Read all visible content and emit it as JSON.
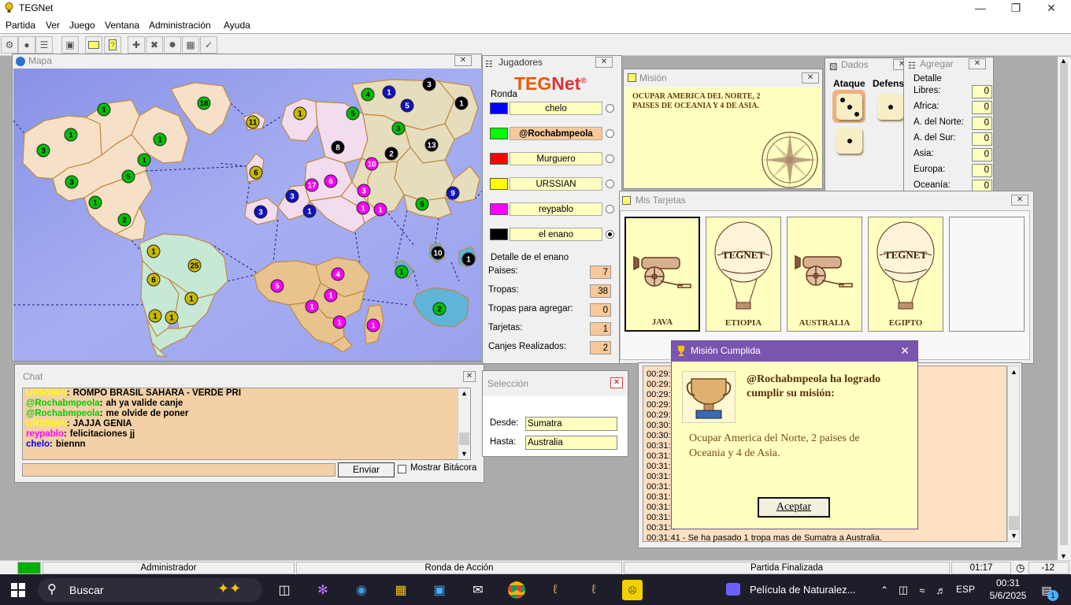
{
  "window": {
    "title": "TEGNet"
  },
  "menu": [
    "Partida",
    "Ver",
    "Juego",
    "Ventana",
    "Administración",
    "Ayuda"
  ],
  "map": {
    "title": "Mapa"
  },
  "players_panel": {
    "title": "Jugadores",
    "logo_teg": "TEG",
    "logo_net": "Net",
    "logo_reg": "®",
    "ronda_label": "Ronda",
    "players": [
      {
        "name": "chelo",
        "color": "#0000ff",
        "selected": false
      },
      {
        "name": "@Rochabmpeola",
        "color": "#00ff00",
        "selected": false
      },
      {
        "name": "Murguero",
        "color": "#ff0000",
        "selected": false
      },
      {
        "name": "URSSIAN",
        "color": "#ffff00",
        "selected": false
      },
      {
        "name": "reypablo",
        "color": "#ff00ff",
        "selected": false
      },
      {
        "name": "el enano",
        "color": "#000000",
        "selected": true
      }
    ],
    "detail_label": "Detalle de el enano",
    "details": [
      {
        "label": "Paises:",
        "value": "7"
      },
      {
        "label": "Tropas:",
        "value": "38"
      },
      {
        "label": "Tropas para agregar:",
        "value": "0"
      },
      {
        "label": "Tarjetas:",
        "value": "1"
      },
      {
        "label": "Canjes Realizados:",
        "value": "2"
      }
    ]
  },
  "mision": {
    "title": "Misión",
    "text_line1": "OCUPAR AMERICA DEL NORTE, 2",
    "text_line2": "PAISES DE OCEANIA Y 4 DE ASIA."
  },
  "dados": {
    "title": "Dados",
    "ataque": "Ataque",
    "defensa": "Defensa",
    "attack": [
      3,
      1
    ],
    "defense": [
      1
    ]
  },
  "agregar": {
    "title": "Agregar",
    "detail_label": "Detalle",
    "rows": [
      {
        "label": "Libres:",
        "value": "0"
      },
      {
        "label": "Africa:",
        "value": "0"
      },
      {
        "label": "A. del Norte:",
        "value": "0"
      },
      {
        "label": "A. del Sur:",
        "value": "0"
      },
      {
        "label": "Asia:",
        "value": "0"
      },
      {
        "label": "Europa:",
        "value": "0"
      },
      {
        "label": "Oceanía:",
        "value": "0"
      }
    ]
  },
  "tarjetas": {
    "title": "Mis Tarjetas",
    "cards": [
      {
        "name": "JAVA",
        "kind": "cannon"
      },
      {
        "name": "ETIOPIA",
        "kind": "balloon",
        "emblem": "TEGNET"
      },
      {
        "name": "AUSTRALIA",
        "kind": "cannon"
      },
      {
        "name": "EGIPTO",
        "kind": "balloon",
        "emblem": "TEGNET"
      }
    ]
  },
  "chat": {
    "title": "Chat",
    "messages": [
      {
        "user": "URSSIAN",
        "sep": ":",
        "text": "ROMPO BRASIL SAHARA - VERDE PRI",
        "color": "#ffff00"
      },
      {
        "user": "@Rochabmpeola",
        "sep": ":",
        "text": "ah ya valide canje",
        "color": "#00d000"
      },
      {
        "user": "@Rochabmpeola",
        "sep": ":",
        "text": "me olvide de poner",
        "color": "#00d000"
      },
      {
        "user": "URSSIAN",
        "sep": ":",
        "text": "JAJJA GENIA",
        "color": "#ffff00"
      },
      {
        "user": "reypablo",
        "sep": ":",
        "text": "felicitaciones jj",
        "color": "#ff00ff"
      },
      {
        "user": "chelo",
        "sep": ":",
        "text": "biennn",
        "color": "#0000ff"
      }
    ],
    "send_label": "Enviar",
    "bitacora_label": "Mostrar Bitácora"
  },
  "seleccion": {
    "title": "Selección",
    "desde_label": "Desde:",
    "desde_value": "Sumatra",
    "hasta_label": "Hasta:",
    "hasta_value": "Australia"
  },
  "bitacora": {
    "times": [
      "00:29:",
      "00:29:",
      "00:29:",
      "00:29:",
      "00:29:",
      "00:30:",
      "00:30:",
      "00:31:0",
      "00:31:0",
      "00:31:0",
      "00:31:1",
      "00:31:2",
      "00:31:3",
      "00:31:4",
      "00:31:4",
      "00:31:4"
    ],
    "last_line": "00:31:41 - Se ha pasado 1 tropa mas de Sumatra a Australia."
  },
  "dialog": {
    "title": "Misión Cumplida",
    "headline_line1": "@Rochabmpeola ha logrado",
    "headline_line2": "cumplir su misión:",
    "body_line1": "Ocupar America del Norte, 2 paises de",
    "body_line2": "Oceania y 4 de Asia.",
    "button_label": "Aceptar"
  },
  "statusbar": {
    "role": "Administrador",
    "phase": "Ronda de Acción",
    "state": "Partida Finalizada",
    "time": "01:17",
    "counter": "-12"
  },
  "taskbar": {
    "search_label": "Buscar",
    "media_label": "Película de Naturalez...",
    "lang": "ESP",
    "clock_time": "00:31",
    "clock_date": "5/6/2025",
    "notif_count": "1"
  },
  "colors": {
    "ocean": "#9aa2ee",
    "north_america": "#f7e0c8",
    "south_america": "#c8e8d6",
    "europe": "#f2dcee",
    "asia": "#e6ddbd",
    "africa": "#e8c38e",
    "oceania": "#5fb4d8"
  }
}
